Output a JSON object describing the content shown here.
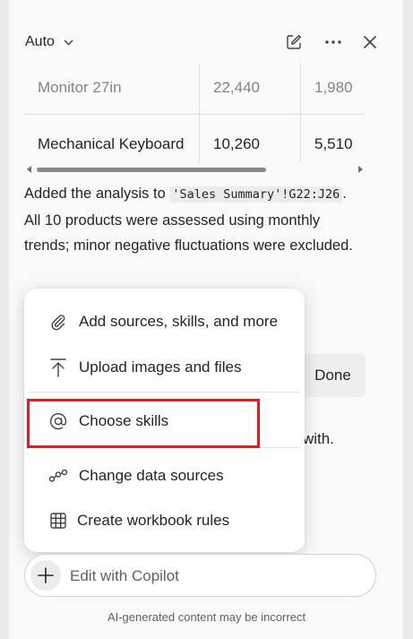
{
  "header": {
    "mode_label": "Auto",
    "icons": [
      "chevron-down-icon",
      "new-chat-icon",
      "more-icon",
      "close-icon"
    ]
  },
  "table": {
    "rows": [
      [
        "Monitor 27in",
        "22,440",
        "1,980"
      ],
      [
        "Mechanical Keyboard",
        "10,260",
        "5,510"
      ]
    ]
  },
  "response": {
    "part1": "Added the analysis to ",
    "code": "'Sales Summary'!G22:J26",
    "part2": ". All 10 products were assessed using monthly trends; minor negative fluctuations were excluded."
  },
  "behind": {
    "done_label": "Done",
    "partial_text": "with."
  },
  "menu": {
    "items": [
      {
        "label": "Add sources, skills, and more",
        "icon": "paperclip-icon"
      },
      {
        "label": "Upload images and files",
        "icon": "upload-icon"
      },
      {
        "label": "Choose skills",
        "icon": "at-sign-icon"
      },
      {
        "label": "Change data sources",
        "icon": "data-sources-icon"
      },
      {
        "label": "Create workbook rules",
        "icon": "grid-icon"
      }
    ],
    "highlight_color": "#e01b24"
  },
  "input": {
    "placeholder": "Edit with Copilot"
  },
  "disclaimer": "AI-generated content may be incorrect"
}
